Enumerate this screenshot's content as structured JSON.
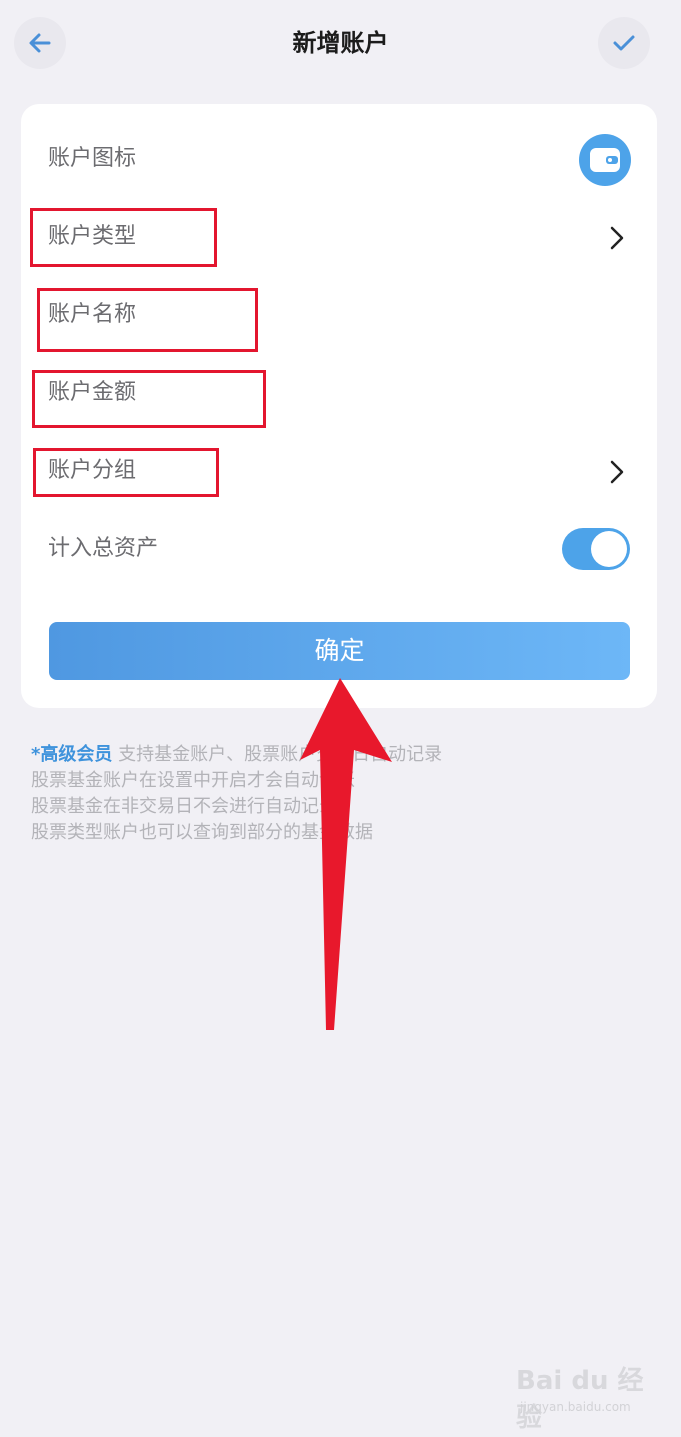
{
  "header": {
    "title": "新增账户",
    "back_icon": "arrow-left-icon",
    "confirm_icon": "check-icon"
  },
  "form": {
    "rows": [
      {
        "label": "账户图标",
        "control": "wallet-icon"
      },
      {
        "label": "账户类型",
        "control": "chevron-right-icon"
      },
      {
        "label": "账户名称",
        "control": "text-input"
      },
      {
        "label": "账户金额",
        "control": "number-input"
      },
      {
        "label": "账户分组",
        "control": "chevron-right-icon"
      },
      {
        "label": "计入总资产",
        "control": "toggle",
        "value": true
      }
    ],
    "confirm_label": "确定"
  },
  "notes": {
    "vip_label": "*高级会员",
    "line1_rest": " 支持基金账户、股票账户交易日自动记录",
    "line2": "股票基金账户在设置中开启才会自动记账",
    "line3": "股票基金在非交易日不会进行自动记录",
    "line4": "股票类型账户也可以查询到部分的基金数据"
  },
  "colors": {
    "accent": "#4da3e9",
    "highlight": "#e3162f",
    "background": "#f1f0f5"
  },
  "watermark": {
    "logo": "Bai du 经验",
    "url": "jingyan.baidu.com"
  }
}
